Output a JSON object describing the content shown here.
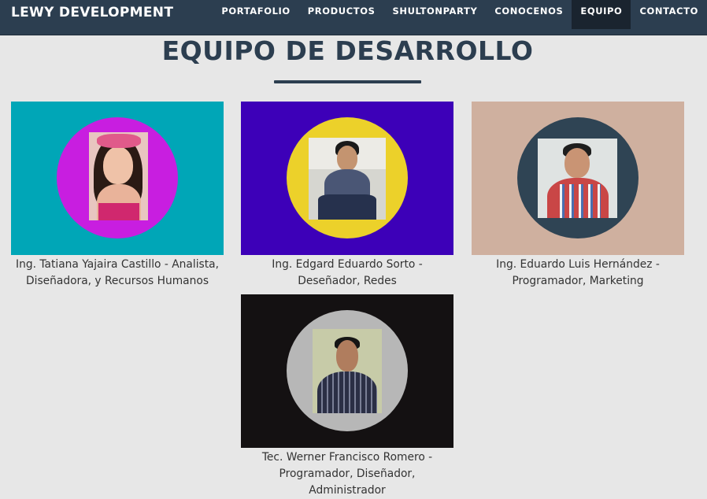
{
  "navbar": {
    "brand": "LEWY DEVELOPMENT",
    "items": [
      {
        "label": "PORTAFOLIO",
        "active": false
      },
      {
        "label": "PRODUCTOS",
        "active": false
      },
      {
        "label": "SHULTONPARTY",
        "active": false
      },
      {
        "label": "CONOCENOS",
        "active": false
      },
      {
        "label": "EQUIPO",
        "active": true
      },
      {
        "label": "CONTACTO",
        "active": false
      }
    ],
    "colors": {
      "background": "#2c3e50",
      "active": "#1a242f"
    }
  },
  "section": {
    "title": "EQUIPO DE DESARROLLO"
  },
  "team": [
    {
      "caption": "Ing. Tatiana Yajaira Castillo - Analista, Diseñadora, y Recursos Humanos",
      "panel_color": "#00a6b7",
      "circle_color": "#c81ee0"
    },
    {
      "caption": "Ing. Edgard Eduardo Sorto - Deseñador, Redes",
      "panel_color": "#3d00b8",
      "circle_color": "#ecd12a"
    },
    {
      "caption": "Ing. Eduardo Luis Hernández - Programador, Marketing",
      "panel_color": "#cfb09f",
      "circle_color": "#2f4454"
    },
    {
      "caption": "Tec. Werner Francisco Romero - Programador, Diseñador, Administrador",
      "panel_color": "#141112",
      "circle_color": "#b7b7b7"
    }
  ]
}
